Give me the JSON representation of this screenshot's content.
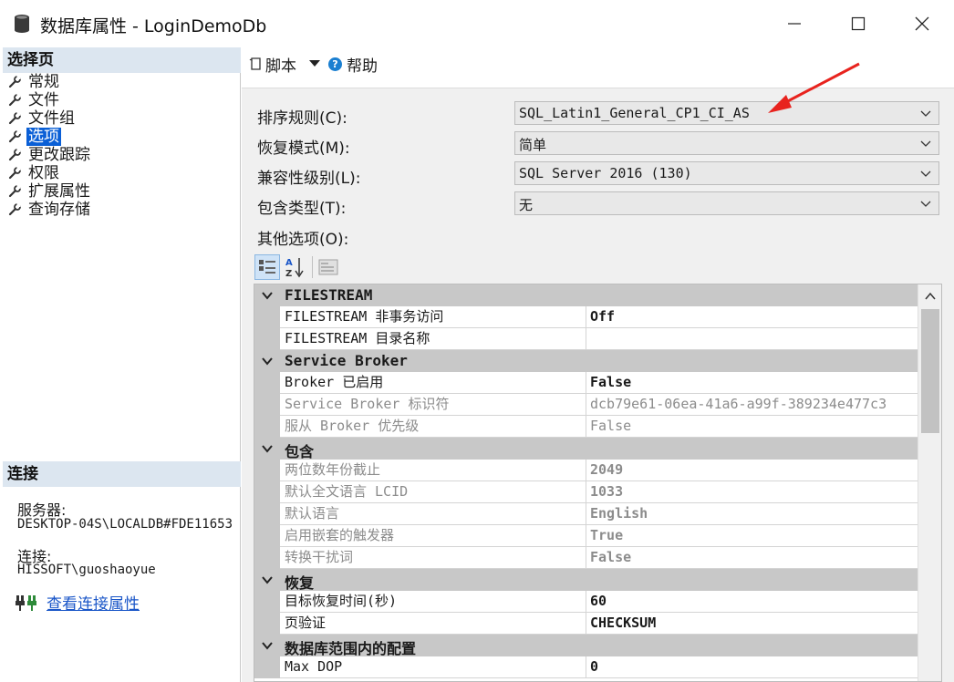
{
  "window": {
    "title": "数据库属性 - LoginDemoDb"
  },
  "left_pane": {
    "select_page_header": "选择页",
    "nav_items": [
      {
        "label": "常规"
      },
      {
        "label": "文件"
      },
      {
        "label": "文件组"
      },
      {
        "label": "选项",
        "selected": true
      },
      {
        "label": "更改跟踪"
      },
      {
        "label": "权限"
      },
      {
        "label": "扩展属性"
      },
      {
        "label": "查询存储"
      }
    ],
    "connection_header": "连接",
    "server_label": "服务器:",
    "server_value": "DESKTOP-04S\\LOCALDB#FDE11653",
    "connection_label": "连接:",
    "connection_value": "HISSOFT\\guoshaoyue",
    "view_conn_link": "查看连接属性"
  },
  "toolbar": {
    "script_label": "脚本",
    "help_label": "帮助"
  },
  "form": {
    "collation_label": "排序规则(C):",
    "collation_value": "SQL_Latin1_General_CP1_CI_AS",
    "recovery_label": "恢复模式(M):",
    "recovery_value": "简单",
    "compat_label": "兼容性级别(L):",
    "compat_value": "SQL Server 2016 (130)",
    "containment_label": "包含类型(T):",
    "containment_value": "无",
    "other_label": "其他选项(O):"
  },
  "grid": {
    "categories": [
      {
        "name": "FILESTREAM",
        "rows": [
          {
            "name": "FILESTREAM 非事务访问",
            "value": "Off",
            "bold": true
          },
          {
            "name": "FILESTREAM 目录名称",
            "value": ""
          }
        ]
      },
      {
        "name": "Service Broker",
        "rows": [
          {
            "name": "Broker 已启用",
            "value": "False",
            "bold": true
          },
          {
            "name": "Service Broker 标识符",
            "value": "dcb79e61-06ea-41a6-a99f-389234e477c3",
            "disabled": true
          },
          {
            "name": "服从 Broker 优先级",
            "value": "False",
            "disabled": true
          }
        ]
      },
      {
        "name": "包含",
        "rows": [
          {
            "name": "两位数年份截止",
            "value": "2049",
            "disabled": true,
            "bold": true
          },
          {
            "name": "默认全文语言 LCID",
            "value": "1033",
            "disabled": true,
            "bold": true
          },
          {
            "name": "默认语言",
            "value": "English",
            "disabled": true,
            "bold": true
          },
          {
            "name": "启用嵌套的触发器",
            "value": "True",
            "disabled": true,
            "bold": true
          },
          {
            "name": "转换干扰词",
            "value": "False",
            "disabled": true,
            "bold": true
          }
        ]
      },
      {
        "name": "恢复",
        "rows": [
          {
            "name": "目标恢复时间(秒)",
            "value": "60",
            "bold": true
          },
          {
            "name": "页验证",
            "value": "CHECKSUM",
            "bold": true
          }
        ]
      },
      {
        "name": "数据库范围内的配置",
        "rows": [
          {
            "name": "Max DOP",
            "value": "0",
            "bold": true
          }
        ]
      }
    ]
  },
  "colors": {
    "selection": "#0a5fd6",
    "header_bg": "#dce6f0",
    "category_bg": "#c8c8c8",
    "link": "#1a56c8",
    "annotation_arrow": "#e8231e"
  },
  "icons": {
    "title": "database-icon",
    "nav": "wrench-icon",
    "help": "help-icon",
    "script": "script-icon",
    "connection": "connection-plug-icon"
  }
}
